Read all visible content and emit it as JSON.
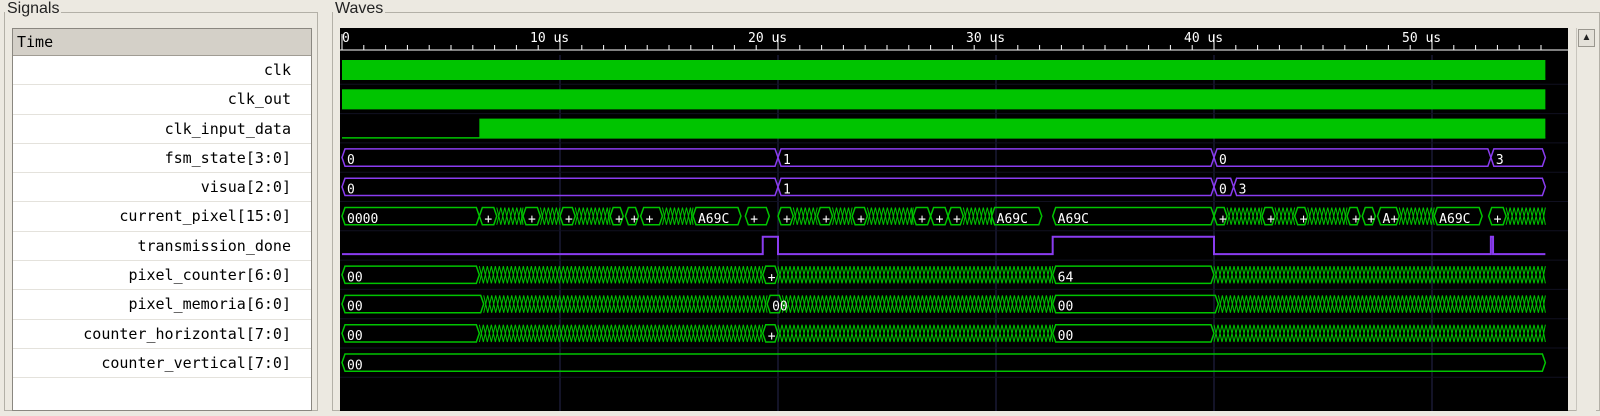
{
  "panels": {
    "signals_title": "Signals",
    "waves_title": "Waves"
  },
  "signals": {
    "header": "Time",
    "rows": [
      "clk",
      "clk_out",
      "clk_input_data",
      "fsm_state[3:0]",
      "visua[2:0]",
      "current_pixel[15:0]",
      "transmission_done",
      "pixel_counter[6:0]",
      "pixel_memoria[6:0]",
      "counter_horizontal[7:0]",
      "counter_vertical[7:0]"
    ]
  },
  "timeline": {
    "ticks": [
      {
        "t": 0,
        "label": "0"
      },
      {
        "t": 10,
        "label": "10 us"
      },
      {
        "t": 20,
        "label": "20 us"
      },
      {
        "t": 30,
        "label": "30 us"
      },
      {
        "t": 40,
        "label": "40 us"
      },
      {
        "t": 50,
        "label": "50 us"
      }
    ],
    "t_max": 55.2
  },
  "waves": {
    "clk": {
      "kind": "dense",
      "segments": [
        [
          0,
          55.2
        ]
      ]
    },
    "clk_out": {
      "kind": "dense",
      "segments": [
        [
          0,
          55.2
        ]
      ]
    },
    "clk_input_data": {
      "kind": "dense",
      "segments": [
        [
          6.3,
          55.2
        ]
      ]
    },
    "fsm_state": {
      "kind": "bus",
      "color": "#8a3cf0",
      "values": [
        {
          "t0": 0,
          "t1": 20,
          "v": "0"
        },
        {
          "t0": 20,
          "t1": 40,
          "v": "1"
        },
        {
          "t0": 40,
          "t1": 52.7,
          "v": "0"
        },
        {
          "t0": 52.7,
          "t1": 55.2,
          "v": "3"
        }
      ]
    },
    "visua": {
      "kind": "bus",
      "color": "#8a3cf0",
      "values": [
        {
          "t0": 0,
          "t1": 20,
          "v": "0"
        },
        {
          "t0": 20,
          "t1": 40,
          "v": "1"
        },
        {
          "t0": 40,
          "t1": 40.9,
          "v": "0"
        },
        {
          "t0": 40.9,
          "t1": 55.2,
          "v": "3"
        }
      ]
    },
    "current_pixel": {
      "kind": "bus",
      "color": "#00c400",
      "values": [
        {
          "t0": 0,
          "t1": 6.3,
          "v": "0000"
        },
        {
          "t0": 6.3,
          "t1": 7.1,
          "v": "+"
        },
        {
          "t0": 8.3,
          "t1": 9.1,
          "v": "+"
        },
        {
          "t0": 10,
          "t1": 10.7,
          "v": "+"
        },
        {
          "t0": 12.3,
          "t1": 12.9,
          "v": "+"
        },
        {
          "t0": 13,
          "t1": 13.6,
          "v": "+"
        },
        {
          "t0": 13.7,
          "t1": 14.7,
          "v": "+"
        },
        {
          "t0": 16.1,
          "t1": 18.3,
          "v": "A69C"
        },
        {
          "t0": 18.5,
          "t1": 19.6,
          "v": "+"
        },
        {
          "t0": 20,
          "t1": 20.7,
          "v": "+"
        },
        {
          "t0": 21.8,
          "t1": 22.5,
          "v": "+"
        },
        {
          "t0": 23.4,
          "t1": 24.1,
          "v": "+"
        },
        {
          "t0": 26.2,
          "t1": 27.0,
          "v": "+"
        },
        {
          "t0": 27.0,
          "t1": 27.8,
          "v": "+"
        },
        {
          "t0": 27.8,
          "t1": 28.5,
          "v": "+"
        },
        {
          "t0": 29.8,
          "t1": 32.1,
          "v": "A69C"
        },
        {
          "t0": 32.6,
          "t1": 40,
          "v": "A69C"
        },
        {
          "t0": 40,
          "t1": 40.6,
          "v": "+"
        },
        {
          "t0": 42.2,
          "t1": 42.8,
          "v": "+"
        },
        {
          "t0": 43.7,
          "t1": 44.3,
          "v": "+"
        },
        {
          "t0": 46.1,
          "t1": 46.7,
          "v": "+"
        },
        {
          "t0": 46.8,
          "t1": 47.4,
          "v": "+"
        },
        {
          "t0": 47.5,
          "t1": 48.5,
          "v": "A+"
        },
        {
          "t0": 50.1,
          "t1": 52.3,
          "v": "A69C"
        },
        {
          "t0": 52.6,
          "t1": 53.4,
          "v": "+"
        }
      ],
      "dense_ranges": [
        [
          7.1,
          8.3
        ],
        [
          9.1,
          10
        ],
        [
          10.7,
          12.3
        ],
        [
          14.7,
          16.1
        ],
        [
          20.7,
          21.8
        ],
        [
          22.5,
          23.4
        ],
        [
          24.1,
          26.2
        ],
        [
          28.5,
          29.8
        ],
        [
          40.6,
          42.2
        ],
        [
          42.8,
          43.7
        ],
        [
          44.3,
          46.1
        ],
        [
          48.5,
          50.1
        ],
        [
          53.4,
          55.2
        ]
      ]
    },
    "transmission_done": {
      "kind": "pulses",
      "color": "#8a3cf0",
      "pulses": [
        [
          19.3,
          20
        ],
        [
          32.6,
          40
        ],
        [
          52.7,
          52.8
        ]
      ]
    },
    "pixel_counter": {
      "kind": "bus",
      "color": "#00c400",
      "values": [
        {
          "t0": 0,
          "t1": 6.3,
          "v": "00"
        },
        {
          "t0": 19.3,
          "t1": 20,
          "v": "+"
        },
        {
          "t0": 32.6,
          "t1": 40,
          "v": "64"
        }
      ],
      "dense_ranges": [
        [
          6.3,
          19.3
        ],
        [
          20,
          32.6
        ],
        [
          40,
          55.2
        ]
      ]
    },
    "pixel_memoria": {
      "kind": "bus",
      "color": "#00c400",
      "values": [
        {
          "t0": 0,
          "t1": 6.5,
          "v": "00"
        },
        {
          "t0": 19.5,
          "t1": 20.2,
          "v": "00"
        },
        {
          "t0": 32.6,
          "t1": 40.2,
          "v": "00"
        }
      ],
      "dense_ranges": [
        [
          6.5,
          19.5
        ],
        [
          20.2,
          32.6
        ],
        [
          40.2,
          55.2
        ]
      ]
    },
    "counter_horizontal": {
      "kind": "bus",
      "color": "#00c400",
      "values": [
        {
          "t0": 0,
          "t1": 6.3,
          "v": "00"
        },
        {
          "t0": 19.3,
          "t1": 20,
          "v": "+"
        },
        {
          "t0": 32.6,
          "t1": 40,
          "v": "00"
        }
      ],
      "dense_ranges": [
        [
          6.3,
          19.3
        ],
        [
          20,
          32.6
        ],
        [
          40,
          55.2
        ]
      ]
    },
    "counter_vertical": {
      "kind": "bus",
      "color": "#00c400",
      "values": [
        {
          "t0": 0,
          "t1": 55.2,
          "v": "00"
        }
      ]
    }
  },
  "colors": {
    "green": "#00c400",
    "purple": "#8a3cf0",
    "grid": "#26264e",
    "ruler": "#ffffff"
  }
}
